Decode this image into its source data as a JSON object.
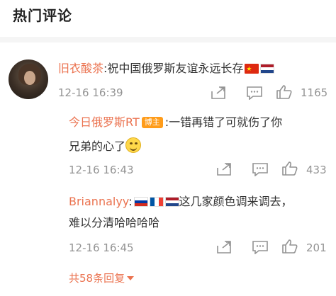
{
  "section": {
    "title": "热门评论"
  },
  "main_comment": {
    "username": "旧衣酸茶",
    "colon": ":",
    "text": "祝中国俄罗斯友谊永远长存",
    "time": "12-16 16:39",
    "likes": "1165",
    "flags": [
      "cn-flag-icon",
      "nl-flag-icon"
    ]
  },
  "replies": [
    {
      "username": "今日俄罗斯RT",
      "badge": "博主",
      "colon": ":",
      "line1": "一错再错了可就伤了你",
      "line2": "兄弟的心了",
      "emoji": "smile-emoji-icon",
      "time": "12-16 16:43",
      "likes": "433"
    },
    {
      "username": "Briannalyy",
      "colon": ":",
      "flags": [
        "ru-flag-icon",
        "fr-flag-icon",
        "nl-flag-icon"
      ],
      "line1": "这几家颜色调来调去，",
      "line2": "难以分清哈哈哈哈",
      "time": "12-16 16:45",
      "likes": "201"
    }
  ],
  "more_replies": {
    "label": "共58条回复"
  },
  "icons": {
    "share": "share-icon",
    "comment": "comment-icon",
    "like": "thumbs-up-icon"
  },
  "colors": {
    "username": "#eb7350",
    "meta": "#939393",
    "badge": "#ff9c1a"
  }
}
